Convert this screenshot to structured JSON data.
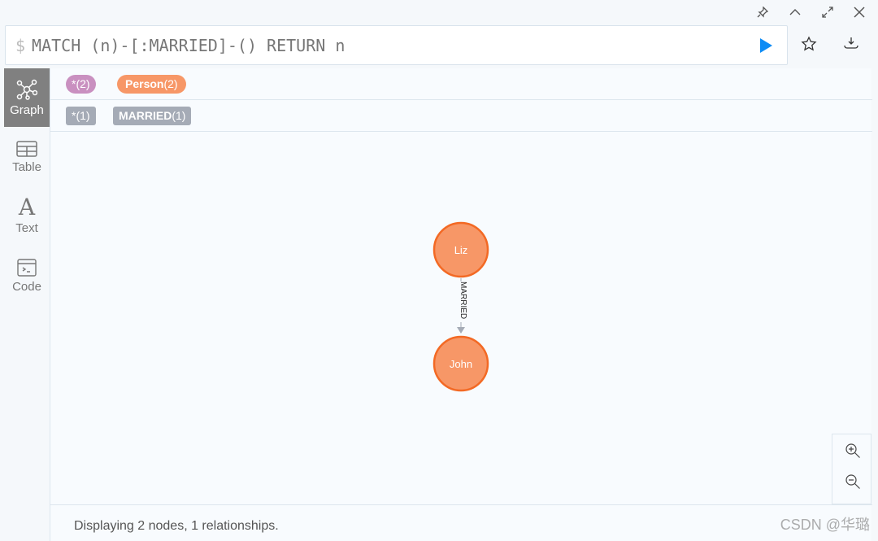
{
  "window_controls": [
    {
      "icon": "pin-icon"
    },
    {
      "icon": "collapse-icon"
    },
    {
      "icon": "expand-icon"
    },
    {
      "icon": "close-icon"
    }
  ],
  "editor": {
    "prompt": "$",
    "query": "MATCH (n)-[:MARRIED]-() RETURN n",
    "run_icon": "play-icon",
    "run_color": "#0e8cf5"
  },
  "toolbar": [
    {
      "icon": "star-icon"
    },
    {
      "icon": "download-icon"
    }
  ],
  "sidebar": {
    "items": [
      {
        "label": "Graph",
        "icon": "graph-icon",
        "active": true
      },
      {
        "label": "Table",
        "icon": "table-icon"
      },
      {
        "label": "Text",
        "icon": "text-icon"
      },
      {
        "label": "Code",
        "icon": "code-icon"
      }
    ]
  },
  "legend": {
    "labels": [
      {
        "name": "*",
        "count": "(2)",
        "color": "#c990c0"
      },
      {
        "name": "Person",
        "count": "(2)",
        "color": "#f79767"
      }
    ],
    "relationships": [
      {
        "name": "*",
        "count": "(1)",
        "color": "#a5abb6"
      },
      {
        "name": "MARRIED",
        "count": "(1)",
        "color": "#a5abb6"
      }
    ]
  },
  "graph": {
    "nodes": [
      {
        "caption": "Liz",
        "color": "#f79767",
        "border": "#f36924"
      },
      {
        "caption": "John",
        "color": "#f79767",
        "border": "#f36924"
      }
    ],
    "relationships": [
      {
        "type": "MARRIED",
        "from": "Liz",
        "to": "John"
      }
    ]
  },
  "zoom_controls": [
    {
      "icon": "zoom-in-icon"
    },
    {
      "icon": "zoom-out-icon"
    }
  ],
  "status": "Displaying 2 nodes, 1 relationships.",
  "watermark": "CSDN @华璐"
}
